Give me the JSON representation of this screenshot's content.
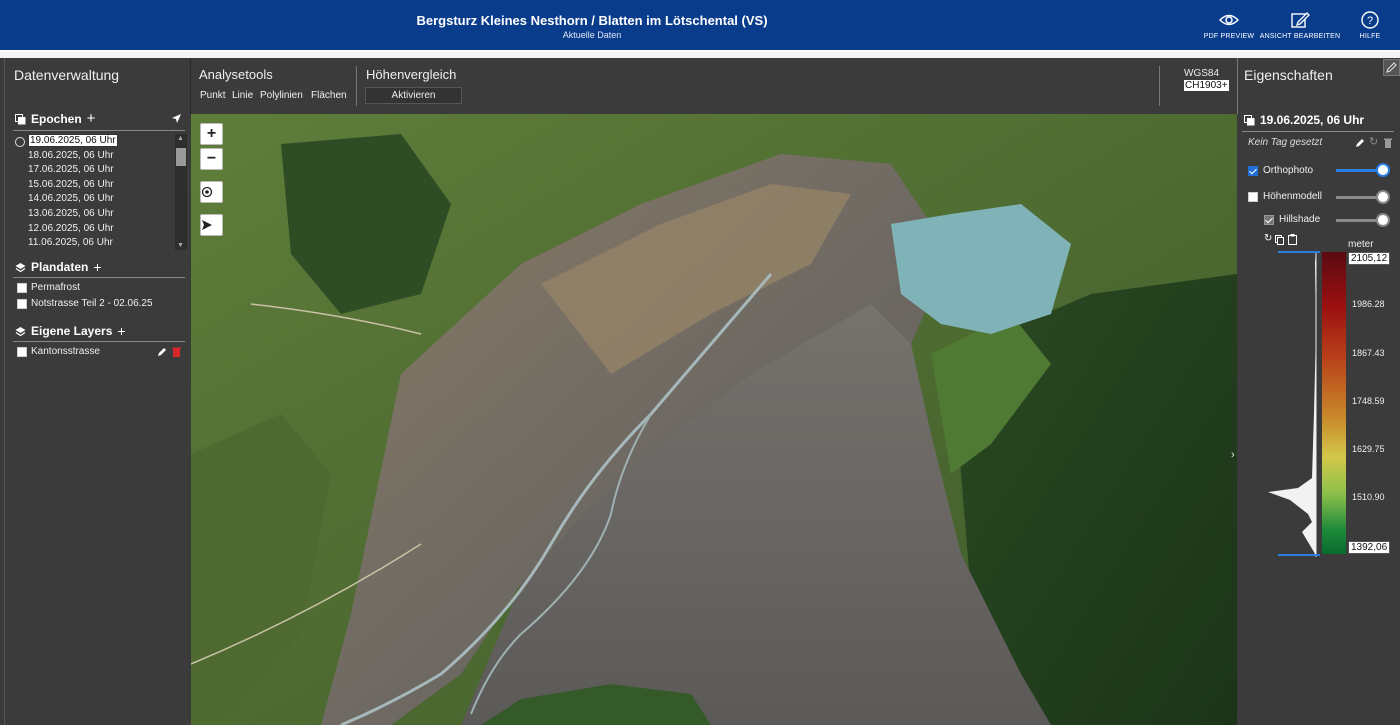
{
  "header": {
    "title": "Bergsturz Kleines Nesthorn / Blatten im Lötschental (VS)",
    "subtitle": "Aktuelle Daten",
    "buttons": [
      {
        "label": "PDF PREVIEW",
        "icon": "eye-icon"
      },
      {
        "label": "ANSICHT BEARBEITEN",
        "icon": "edit-icon"
      },
      {
        "label": "HILFE",
        "icon": "help-icon"
      }
    ],
    "accent": "#0a3c8c"
  },
  "left": {
    "title": "Datenverwaltung",
    "epochs_label": "Epochen",
    "epochs": [
      "19.06.2025, 06 Uhr",
      "18.06.2025, 06 Uhr",
      "17.06.2025, 06 Uhr",
      "15.06.2025, 06 Uhr",
      "14.06.2025, 06 Uhr",
      "13.06.2025, 06 Uhr",
      "12.06.2025, 06 Uhr",
      "11.06.2025, 06 Uhr"
    ],
    "plandaten_label": "Plandaten",
    "plandaten": [
      "Permafrost",
      "Notstrasse Teil 2 - 02.06.25"
    ],
    "layers_label": "Eigene Layers",
    "layers": [
      "Kantonsstrasse"
    ]
  },
  "toolbar": {
    "analysis_title": "Analysetools",
    "tools": [
      "Punkt",
      "Linie",
      "Polylinien",
      "Flächen"
    ],
    "compare_title": "Höhenvergleich",
    "compare_button": "Aktivieren",
    "crs_1": "WGS84",
    "crs_2": "CH1903+"
  },
  "right": {
    "title": "Eigenschaften",
    "date": "19.06.2025, 06 Uhr",
    "tag": "Kein Tag gesetzt",
    "layers": [
      {
        "label": "Orthophoto",
        "checked": true
      },
      {
        "label": "Höhenmodell",
        "checked": false
      },
      {
        "label": "Hillshade",
        "checked": true
      }
    ],
    "unit": "meter",
    "max_value": "2105,12",
    "min_value": "1392,06",
    "ticks": [
      "1986.28",
      "1867.43",
      "1748.59",
      "1629.75",
      "1510.90"
    ]
  }
}
